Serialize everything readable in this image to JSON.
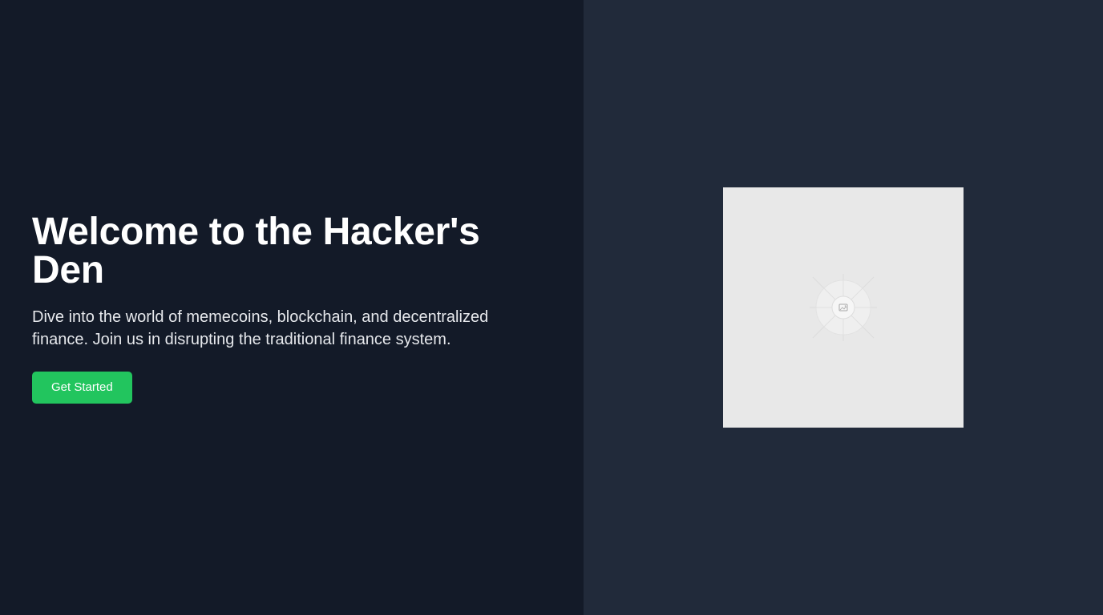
{
  "hero": {
    "title": "Welcome to the Hacker's Den",
    "subtitle": "Dive into the world of memecoins, blockchain, and decentralized finance. Join us in disrupting the traditional finance system.",
    "cta_label": "Get Started"
  },
  "media": {
    "icon": "image-placeholder-icon"
  },
  "colors": {
    "left_background": "#131a28",
    "right_background": "#212a3a",
    "accent": "#22c55e",
    "placeholder_background": "#e8e8e8"
  }
}
